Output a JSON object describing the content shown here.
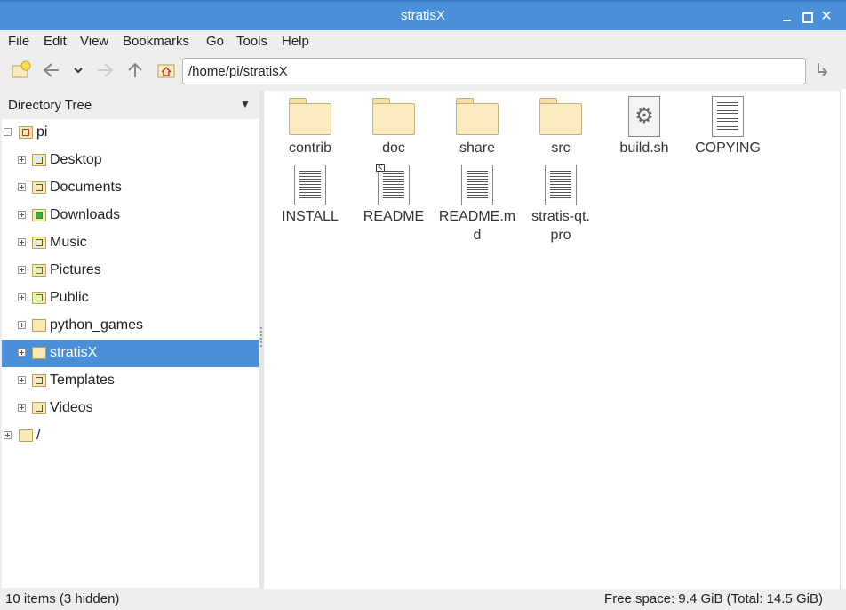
{
  "window": {
    "title": "stratisX"
  },
  "menubar": {
    "items": [
      "File",
      "Edit",
      "View",
      "Bookmarks",
      "Go",
      "Tools",
      "Help"
    ]
  },
  "toolbar": {
    "path": "/home/pi/stratisX",
    "icons": [
      "new-tab-icon",
      "back-icon",
      "history-dropdown-icon",
      "forward-icon",
      "up-icon",
      "home-icon",
      "go-icon"
    ]
  },
  "sidebar": {
    "header": "Directory Tree",
    "root": "pi",
    "items": [
      {
        "label": "Desktop",
        "icon": "desktop-icon"
      },
      {
        "label": "Documents",
        "icon": "documents-icon"
      },
      {
        "label": "Downloads",
        "icon": "downloads-icon"
      },
      {
        "label": "Music",
        "icon": "music-icon"
      },
      {
        "label": "Pictures",
        "icon": "pictures-icon"
      },
      {
        "label": "Public",
        "icon": "public-icon"
      },
      {
        "label": "python_games",
        "icon": "folder-icon"
      },
      {
        "label": "stratisX",
        "icon": "folder-icon",
        "selected": true
      },
      {
        "label": "Templates",
        "icon": "templates-icon"
      },
      {
        "label": "Videos",
        "icon": "videos-icon"
      }
    ],
    "filesystem_root": "/"
  },
  "files": [
    {
      "name": "contrib",
      "type": "folder"
    },
    {
      "name": "doc",
      "type": "folder"
    },
    {
      "name": "share",
      "type": "folder"
    },
    {
      "name": "src",
      "type": "folder"
    },
    {
      "name": "build.sh",
      "type": "script"
    },
    {
      "name": "COPYING",
      "type": "text"
    },
    {
      "name": "INSTALL",
      "type": "text"
    },
    {
      "name": "README",
      "type": "symlink-text"
    },
    {
      "name": "README.md",
      "type": "text"
    },
    {
      "name": "stratis-qt.pro",
      "type": "text"
    }
  ],
  "status": {
    "left": "10 items (3 hidden)",
    "right": "Free space: 9.4 GiB (Total: 14.5 GiB)"
  },
  "colors": {
    "titlebar": "#4a90d9",
    "selection": "#4a90d9",
    "folder": "#faebc0"
  }
}
